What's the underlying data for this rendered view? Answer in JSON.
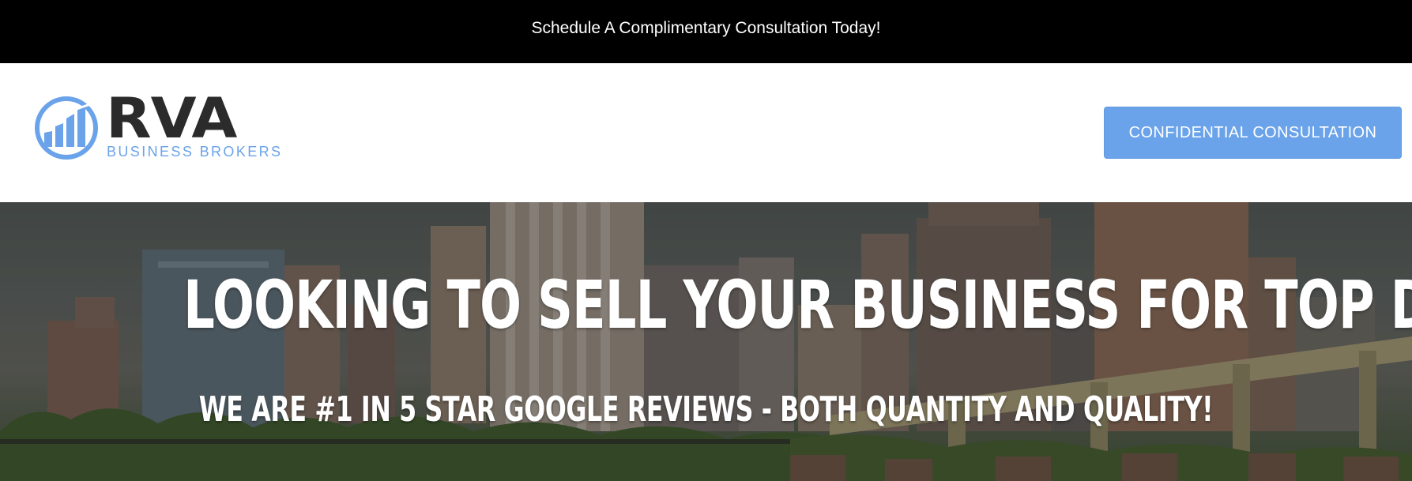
{
  "announcement_bar": {
    "text": "Schedule A Complimentary Consultation Today!"
  },
  "header": {
    "logo": {
      "wordmark": "RVA",
      "tagline": "BUSINESS BROKERS",
      "icon": "bar-chart-circle-icon"
    },
    "cta_label": "CONFIDENTIAL CONSULTATION"
  },
  "hero": {
    "title": "LOOKING TO SELL YOUR BUSINESS FOR TOP DOLLAR?",
    "subtitle": "WE ARE #1 IN 5 STAR GOOGLE REVIEWS - BOTH QUANTITY AND QUALITY!",
    "background": "city-skyline-image"
  },
  "colors": {
    "accent": "#6aa3ea",
    "announcement_bg": "#000000",
    "logo_dark": "#2b2b2b"
  }
}
